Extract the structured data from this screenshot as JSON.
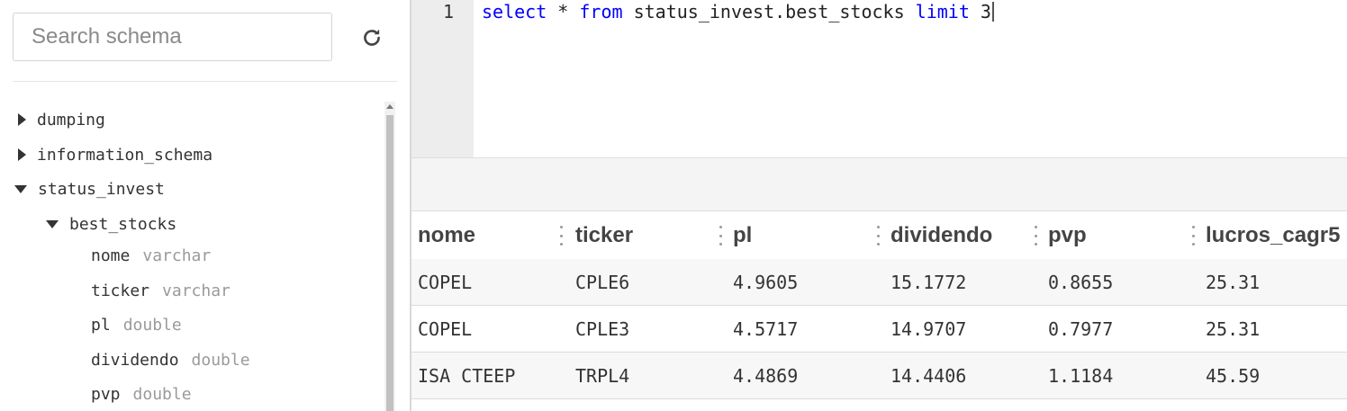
{
  "sidebar": {
    "search_placeholder": "Search schema",
    "refresh_icon": "refresh-icon",
    "schemas": [
      {
        "name": "dumping",
        "expanded": false
      },
      {
        "name": "information_schema",
        "expanded": false
      },
      {
        "name": "status_invest",
        "expanded": true
      }
    ],
    "table": {
      "name": "best_stocks",
      "expanded": true
    },
    "columns": [
      {
        "name": "nome",
        "type": "varchar"
      },
      {
        "name": "ticker",
        "type": "varchar"
      },
      {
        "name": "pl",
        "type": "double"
      },
      {
        "name": "dividendo",
        "type": "double"
      },
      {
        "name": "pvp",
        "type": "double"
      }
    ]
  },
  "editor": {
    "line_number": "1",
    "tokens": {
      "kw_select": "select",
      "star": " * ",
      "kw_from": "from",
      "table_ref": " status_invest.best_stocks ",
      "kw_limit": "limit",
      "limit_value": " 3"
    }
  },
  "results": {
    "columns": [
      "nome",
      "ticker",
      "pl",
      "dividendo",
      "pvp",
      "lucros_cagr5"
    ],
    "rows": [
      [
        "COPEL",
        "CPLE6",
        "4.9605",
        "15.1772",
        "0.8655",
        "25.31"
      ],
      [
        "COPEL",
        "CPLE3",
        "4.5717",
        "14.9707",
        "0.7977",
        "25.31"
      ],
      [
        "ISA CTEEP",
        "TRPL4",
        "4.4869",
        "14.4406",
        "1.1184",
        "45.59"
      ]
    ]
  }
}
